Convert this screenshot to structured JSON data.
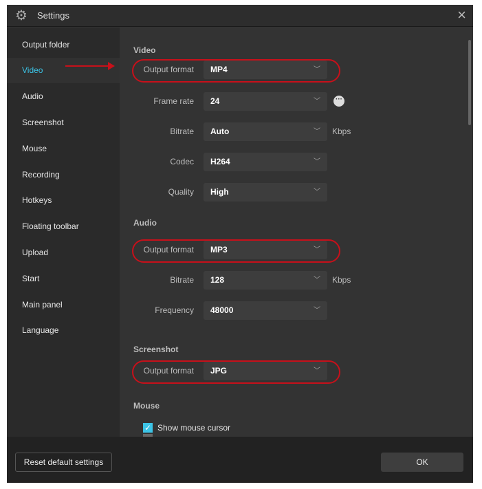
{
  "window": {
    "title": "Settings",
    "icon": "gear-icon",
    "close": "×"
  },
  "sidebar": {
    "items": [
      {
        "label": "Output folder"
      },
      {
        "label": "Video",
        "active": true
      },
      {
        "label": "Audio"
      },
      {
        "label": "Screenshot"
      },
      {
        "label": "Mouse"
      },
      {
        "label": "Recording"
      },
      {
        "label": "Hotkeys"
      },
      {
        "label": "Floating toolbar"
      },
      {
        "label": "Upload"
      },
      {
        "label": "Start"
      },
      {
        "label": "Main panel"
      },
      {
        "label": "Language"
      }
    ]
  },
  "video": {
    "header": "Video",
    "output_format": {
      "label": "Output format",
      "value": "MP4"
    },
    "frame_rate": {
      "label": "Frame rate",
      "value": "24",
      "more": "···"
    },
    "bitrate": {
      "label": "Bitrate",
      "value": "Auto",
      "unit": "Kbps"
    },
    "codec": {
      "label": "Codec",
      "value": "H264"
    },
    "quality": {
      "label": "Quality",
      "value": "High"
    }
  },
  "audio": {
    "header": "Audio",
    "output_format": {
      "label": "Output format",
      "value": "MP3"
    },
    "bitrate": {
      "label": "Bitrate",
      "value": "128",
      "unit": "Kbps"
    },
    "frequency": {
      "label": "Frequency",
      "value": "48000"
    }
  },
  "screenshot": {
    "header": "Screenshot",
    "output_format": {
      "label": "Output format",
      "value": "JPG"
    }
  },
  "mouse": {
    "header": "Mouse",
    "show_cursor": {
      "label": "Show mouse cursor",
      "checked": true
    }
  },
  "footer": {
    "reset": "Reset default settings",
    "ok": "OK"
  },
  "colors": {
    "accent": "#3cc4e6",
    "annotation": "#c8101a"
  }
}
